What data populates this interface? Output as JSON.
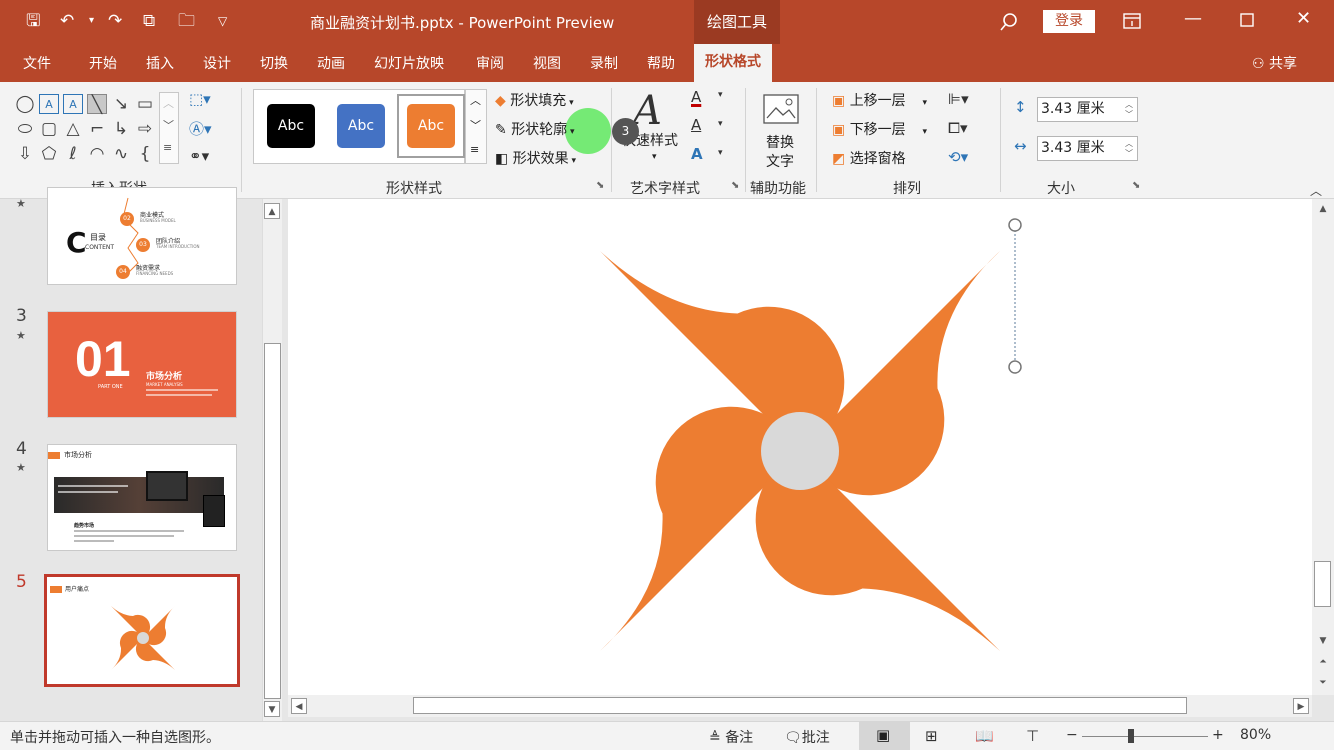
{
  "titlebar": {
    "filename": "商业融资计划书.pptx",
    "separator": "-",
    "app": "PowerPoint Preview",
    "context_tab": "绘图工具",
    "login": "登录"
  },
  "tabs": [
    "文件",
    "开始",
    "插入",
    "设计",
    "切换",
    "动画",
    "幻灯片放映",
    "审阅",
    "视图",
    "录制",
    "帮助"
  ],
  "active_tab": "形状格式",
  "share": "共享",
  "ribbon": {
    "insert_shapes_label": "插入形状",
    "styles_label": "形状样式",
    "wordart_label": "艺术字样式",
    "accessibility_label": "辅助功能",
    "arrange_label": "排列",
    "size_label": "大小",
    "abc": [
      "Abc",
      "Abc",
      "Abc"
    ],
    "fill": "形状填充",
    "outline": "形状轮廓",
    "effects": "形状效果",
    "quick_styles": "快速样式",
    "badge": "3",
    "alt_text_1": "替换",
    "alt_text_2": "文字",
    "bring_forward": "上移一层",
    "send_backward": "下移一层",
    "selection_pane": "选择窗格",
    "height": "3.43 厘米",
    "width": "3.43 厘米"
  },
  "thumbs": {
    "num3": "3",
    "num4": "4",
    "num5": "5",
    "s2_toc_big": "C",
    "s2_toc_title": "目录",
    "s2_toc_sub": "CONTENT",
    "s2_items": [
      {
        "n": "02",
        "t": "商业模式",
        "s": "BUSINESS MODEL"
      },
      {
        "n": "03",
        "t": "团队介绍",
        "s": "TEAM INTRODUCTION"
      },
      {
        "n": "04",
        "t": "融资需求",
        "s": "FINANCING NEEDS"
      }
    ],
    "s3_big": "01",
    "s3_part": "PART ONE",
    "s3_title": "市场分析",
    "s3_sub": "MARKET ANALYSIS",
    "s4_title": "市场分析",
    "s4_block": "趋势市场",
    "s5_title": "用户痛点"
  },
  "status": {
    "hint": "单击并拖动可插入一种自选图形。",
    "notes": "备注",
    "comments": "批注",
    "zoom": "80%"
  },
  "colors": {
    "accent": "#b7472a",
    "orange": "#ed7d31",
    "center_circle": "#d9d9d9",
    "cursor_highlight": "#5ee85e"
  }
}
